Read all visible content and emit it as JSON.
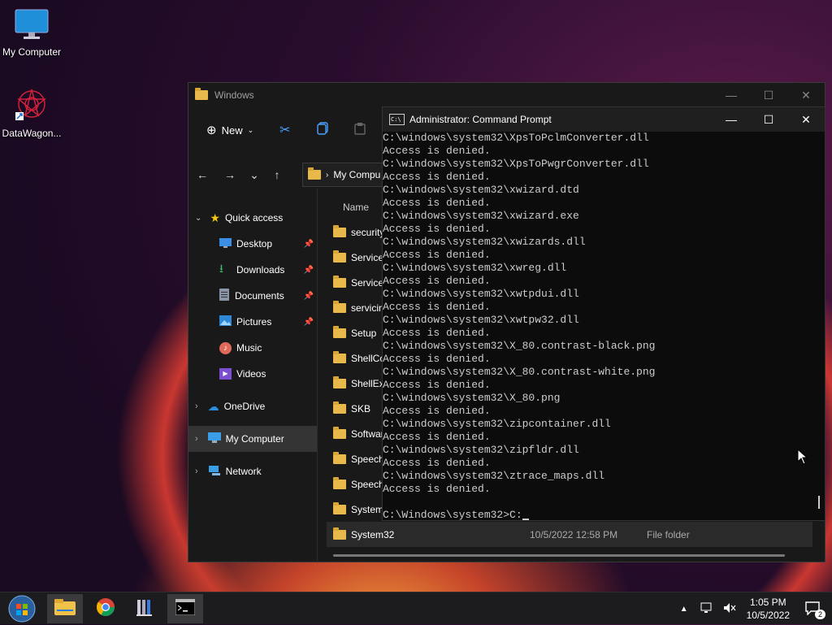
{
  "desktop": {
    "icons": [
      {
        "label": "My Computer"
      },
      {
        "label": "DataWagon..."
      }
    ]
  },
  "explorer": {
    "title": "Windows",
    "toolbar": {
      "new_label": "New"
    },
    "address": {
      "crumb": "My Compu"
    },
    "sidebar": [
      {
        "label": "Quick access"
      },
      {
        "label": "Desktop"
      },
      {
        "label": "Downloads"
      },
      {
        "label": "Documents"
      },
      {
        "label": "Pictures"
      },
      {
        "label": "Music"
      },
      {
        "label": "Videos"
      },
      {
        "label": "OneDrive"
      },
      {
        "label": "My Computer"
      },
      {
        "label": "Network"
      }
    ],
    "columns": {
      "name": "Name"
    },
    "rows": [
      {
        "name": "security"
      },
      {
        "name": "ServiceP"
      },
      {
        "name": "ServiceS"
      },
      {
        "name": "servicin"
      },
      {
        "name": "Setup"
      },
      {
        "name": "ShellCo"
      },
      {
        "name": "ShellExp"
      },
      {
        "name": "SKB"
      },
      {
        "name": "Softwar"
      },
      {
        "name": "Speech"
      },
      {
        "name": "Speech_"
      },
      {
        "name": "System"
      },
      {
        "name": "System32",
        "date": "10/5/2022 12:58 PM",
        "type": "File folder"
      }
    ]
  },
  "cmd": {
    "title": "Administrator: Command Prompt",
    "icon_text": "C:\\",
    "lines": [
      "C:\\windows\\system32\\XpsToPclmConverter.dll",
      "Access is denied.",
      "C:\\windows\\system32\\XpsToPwgrConverter.dll",
      "Access is denied.",
      "C:\\windows\\system32\\xwizard.dtd",
      "Access is denied.",
      "C:\\windows\\system32\\xwizard.exe",
      "Access is denied.",
      "C:\\windows\\system32\\xwizards.dll",
      "Access is denied.",
      "C:\\windows\\system32\\xwreg.dll",
      "Access is denied.",
      "C:\\windows\\system32\\xwtpdui.dll",
      "Access is denied.",
      "C:\\windows\\system32\\xwtpw32.dll",
      "Access is denied.",
      "C:\\windows\\system32\\X_80.contrast-black.png",
      "Access is denied.",
      "C:\\windows\\system32\\X_80.contrast-white.png",
      "Access is denied.",
      "C:\\windows\\system32\\X_80.png",
      "Access is denied.",
      "C:\\windows\\system32\\zipcontainer.dll",
      "Access is denied.",
      "C:\\windows\\system32\\zipfldr.dll",
      "Access is denied.",
      "C:\\windows\\system32\\ztrace_maps.dll",
      "Access is denied.",
      ""
    ],
    "prompt": "C:\\Windows\\system32>C:"
  },
  "taskbar": {
    "time": "1:05 PM",
    "date": "10/5/2022",
    "notification_count": "2"
  },
  "colors": {
    "folder": "#e8b84a",
    "accent": "#0078d4",
    "console_bg": "#0c0c0c"
  }
}
